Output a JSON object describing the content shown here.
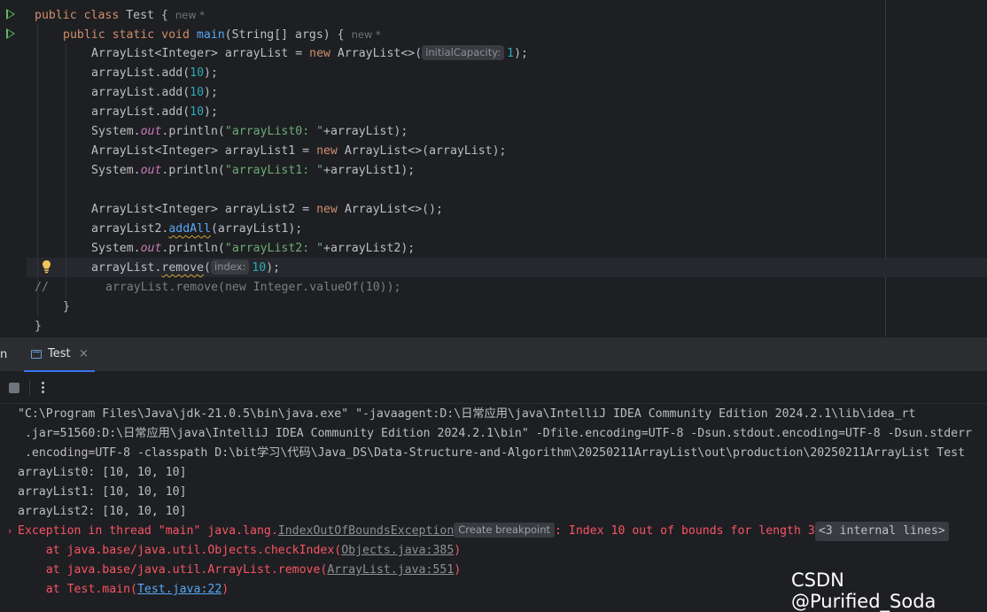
{
  "editor": {
    "line1": {
      "kw": "public class",
      "cls": " Test {",
      "hint": "new *"
    },
    "line2": {
      "kw": "public static void",
      "fn": "main",
      "rest": "(String[] args) {",
      "hint": "new *"
    },
    "line3": {
      "a": "ArrayList<Integer> arrayList = ",
      "kw": "new",
      "b": " ArrayList<>(",
      "hint": "initialCapacity:",
      "num": "1",
      "c": ");"
    },
    "line4": {
      "a": "arrayList.add(",
      "num": "10",
      "b": ");"
    },
    "line5": {
      "a": "arrayList.add(",
      "num": "10",
      "b": ");"
    },
    "line6": {
      "a": "arrayList.add(",
      "num": "10",
      "b": ");"
    },
    "line7": {
      "a": "System.",
      "fld": "out",
      "b": ".println(",
      "str": "\"arrayList0: \"",
      "c": "+arrayList);"
    },
    "line8": {
      "a": "ArrayList<Integer> arrayList1 = ",
      "kw": "new",
      "b": " ArrayList<>(arrayList);"
    },
    "line9": {
      "a": "System.",
      "fld": "out",
      "b": ".println(",
      "str": "\"arrayList1: \"",
      "c": "+arrayList1);"
    },
    "line11": {
      "a": "ArrayList<Integer> arrayList2 = ",
      "kw": "new",
      "b": " ArrayList<>();"
    },
    "line12": {
      "a": "arrayList2.",
      "sq": "addAll",
      "b": "(arrayList1);"
    },
    "line13": {
      "a": "System.",
      "fld": "out",
      "b": ".println(",
      "str": "\"arrayList2: \"",
      "c": "+arrayList2);"
    },
    "line14": {
      "a": "arrayList.",
      "sq": "remove",
      "b": "(",
      "hint": "index:",
      "num": "10",
      "c": ");"
    },
    "line15": {
      "slash": "//",
      "cmt": "arrayList.remove(new Integer.valueOf(10));"
    },
    "line16": "}",
    "line17": "}"
  },
  "tabs": {
    "clipped_label": "n",
    "active_label": "Test",
    "close_glyph": "×"
  },
  "console": {
    "cmd1": "\"C:\\Program Files\\Java\\jdk-21.0.5\\bin\\java.exe\" \"-javaagent:D:\\日常应用\\java\\IntelliJ IDEA Community Edition 2024.2.1\\lib\\idea_rt",
    "cmd2": " .jar=51560:D:\\日常应用\\java\\IntelliJ IDEA Community Edition 2024.2.1\\bin\" -Dfile.encoding=UTF-8 -Dsun.stdout.encoding=UTF-8 -Dsun.stderr",
    "cmd3": " .encoding=UTF-8 -classpath D:\\bit学习\\代码\\Java_DS\\Data-Structure-and-Algorithm\\20250211ArrayList\\out\\production\\20250211ArrayList Test",
    "out1": "arrayList0: [10, 10, 10]",
    "out2": "arrayList1: [10, 10, 10]",
    "out3": "arrayList2: [10, 10, 10]",
    "exc_prefix": "Exception in thread \"main\" java.lang.",
    "exc_class": "IndexOutOfBoundsException",
    "bp_hint": "Create breakpoint",
    "exc_msg": ": Index 10 out of bounds for length 3",
    "internal": "<3 internal lines>",
    "st1_prefix": "    at java.base/java.util.Objects.checkIndex(",
    "st1_link": "Objects.java:385",
    "st2_prefix": "    at java.base/java.util.ArrayList.remove(",
    "st2_link": "ArrayList.java:551",
    "st3_prefix": "    at Test.main(",
    "st3_link": "Test.java:22",
    "close_paren": ")"
  },
  "watermark": "CSDN @Purified_Soda",
  "colors": {
    "keyword": "#cf8e6d",
    "function": "#56a8f5",
    "number": "#2aacb8",
    "string": "#6aab73",
    "error": "#f75464",
    "run_icon": "#5fb865"
  }
}
